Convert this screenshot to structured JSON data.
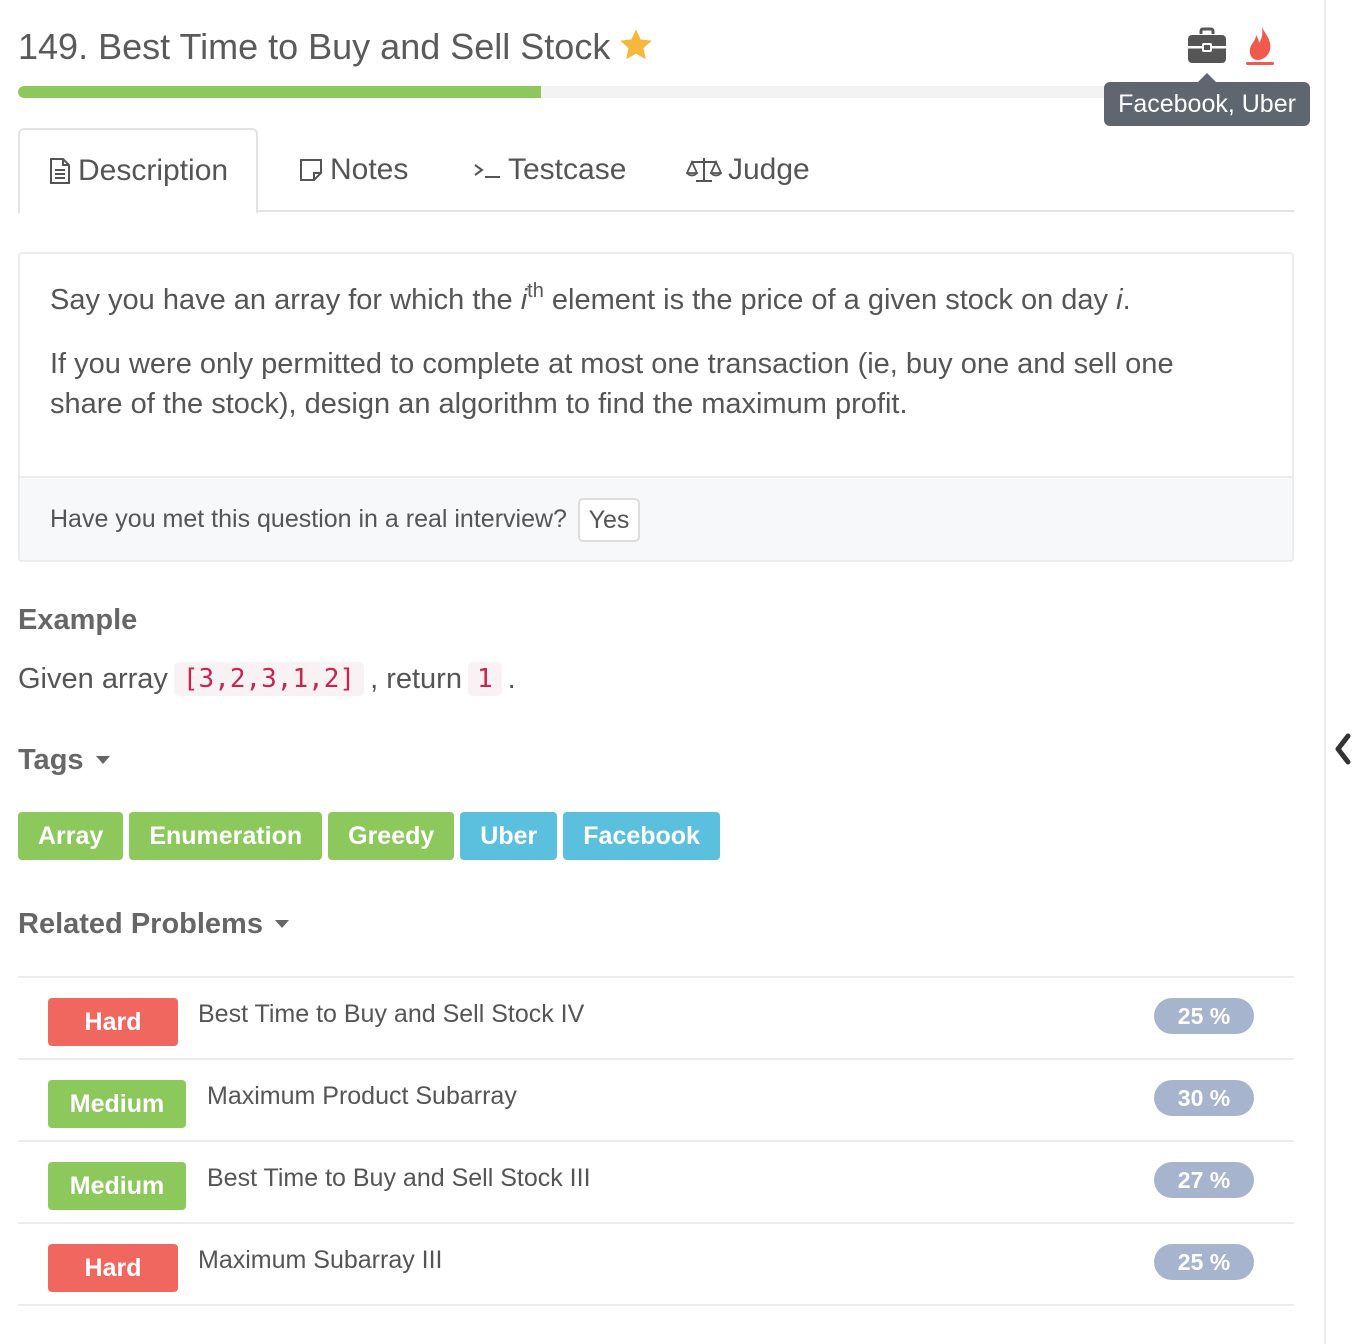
{
  "header": {
    "title": "149. Best Time to Buy and Sell Stock",
    "progress_percent": 41,
    "company_tooltip": "Facebook, Uber"
  },
  "tabs": [
    {
      "label": "Description",
      "icon": "document-icon",
      "active": true
    },
    {
      "label": "Notes",
      "icon": "note-icon",
      "active": false
    },
    {
      "label": "Testcase",
      "icon": "terminal-icon",
      "active": false
    },
    {
      "label": "Judge",
      "icon": "scale-icon",
      "active": false
    }
  ],
  "description": {
    "p1_before": "Say you have an array for which the ",
    "p1_var": "i",
    "p1_sup": "th",
    "p1_middle": " element is the price of a given stock on day ",
    "p1_day": "i",
    "p1_end": ".",
    "p2": "If you were only permitted to complete at most one transaction (ie, buy one and sell one share of the stock), design an algorithm to find the maximum profit.",
    "interview_question": "Have you met this question in a real interview?",
    "yes_label": "Yes"
  },
  "example": {
    "heading": "Example",
    "prefix": "Given array",
    "array_code": "[3,2,3,1,2]",
    "middle": ", return",
    "result_code": "1",
    "suffix": "."
  },
  "tags": {
    "heading": "Tags",
    "items": [
      {
        "label": "Array",
        "color": "#8dc85d"
      },
      {
        "label": "Enumeration",
        "color": "#8dc85d"
      },
      {
        "label": "Greedy",
        "color": "#8dc85d"
      },
      {
        "label": "Uber",
        "color": "#5bc0de"
      },
      {
        "label": "Facebook",
        "color": "#5bc0de"
      }
    ]
  },
  "related": {
    "heading": "Related Problems",
    "items": [
      {
        "difficulty": "Hard",
        "title": "Best Time to Buy and Sell Stock IV",
        "percent": "25 %"
      },
      {
        "difficulty": "Medium",
        "title": "Maximum Product Subarray",
        "percent": "30 %"
      },
      {
        "difficulty": "Medium",
        "title": "Best Time to Buy and Sell Stock III",
        "percent": "27 %"
      },
      {
        "difficulty": "Hard",
        "title": "Maximum Subarray III",
        "percent": "25 %"
      }
    ]
  },
  "colors": {
    "accent_green": "#8dc85d",
    "accent_blue": "#5bc0de",
    "hard_red": "#f0675f",
    "star_gold": "#f6b83a",
    "fire_red": "#ef5a4c"
  }
}
